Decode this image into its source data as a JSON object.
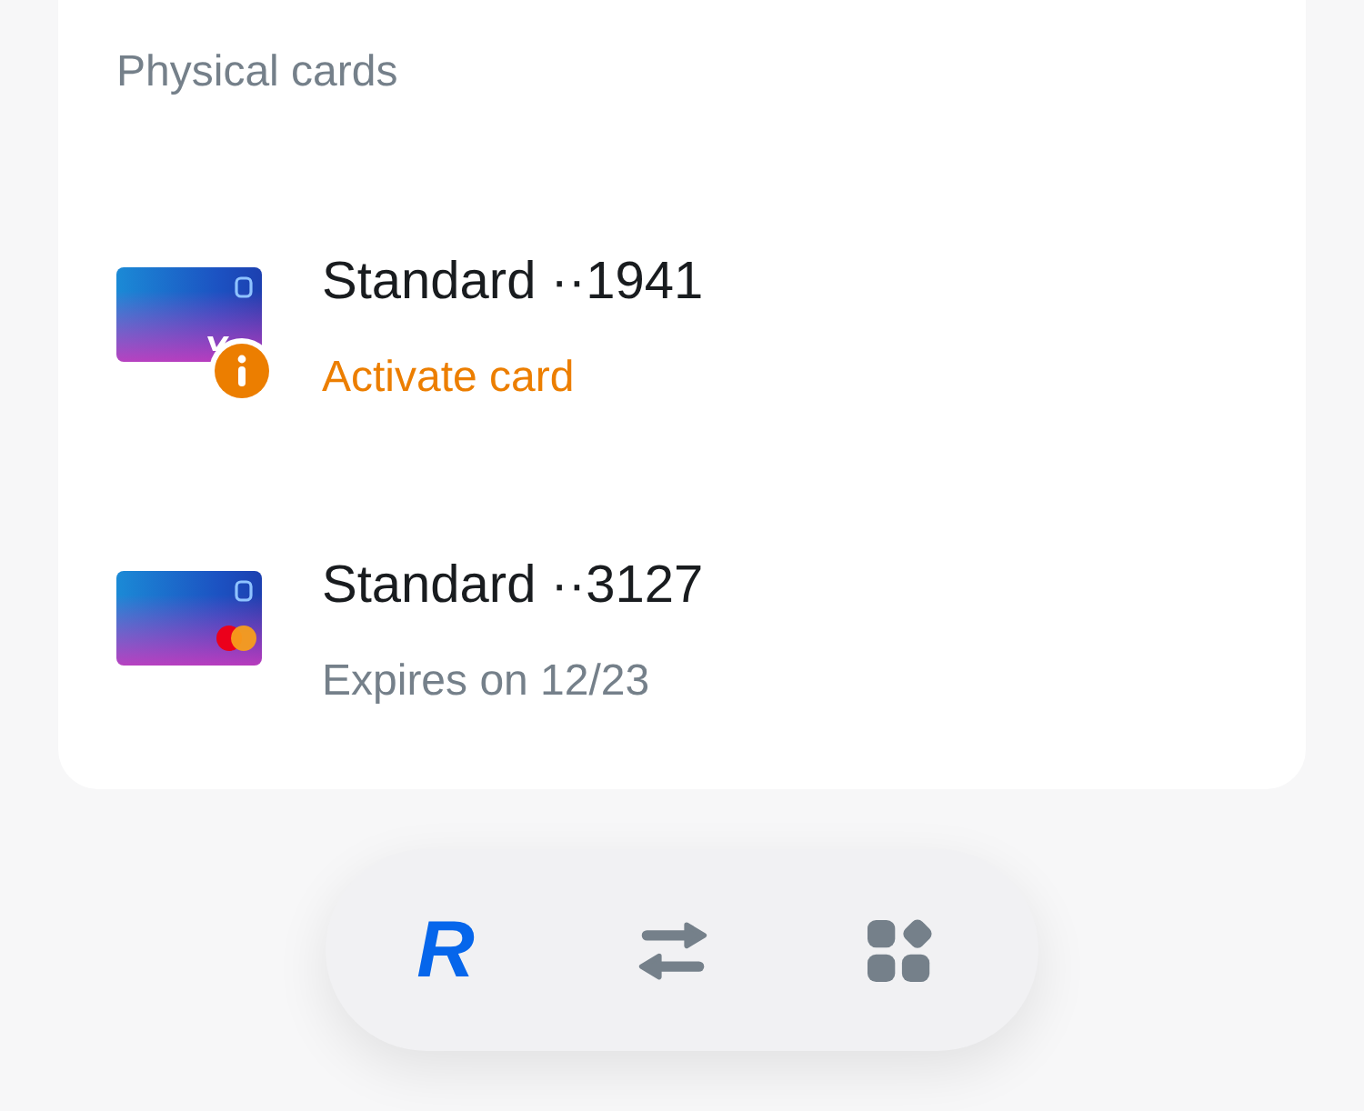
{
  "section": {
    "title": "Physical cards"
  },
  "cards": [
    {
      "name": "Standard ··1941",
      "status": "Activate card",
      "alert": true,
      "kind": "visa"
    },
    {
      "name": "Standard ··3127",
      "status": "Expires on 12/23",
      "alert": false,
      "kind": "mastercard"
    }
  ],
  "nav": [
    {
      "kind": "home",
      "glyph": "R",
      "selected": true
    },
    {
      "kind": "transfers",
      "selected": false
    },
    {
      "kind": "hub",
      "selected": false
    }
  ]
}
